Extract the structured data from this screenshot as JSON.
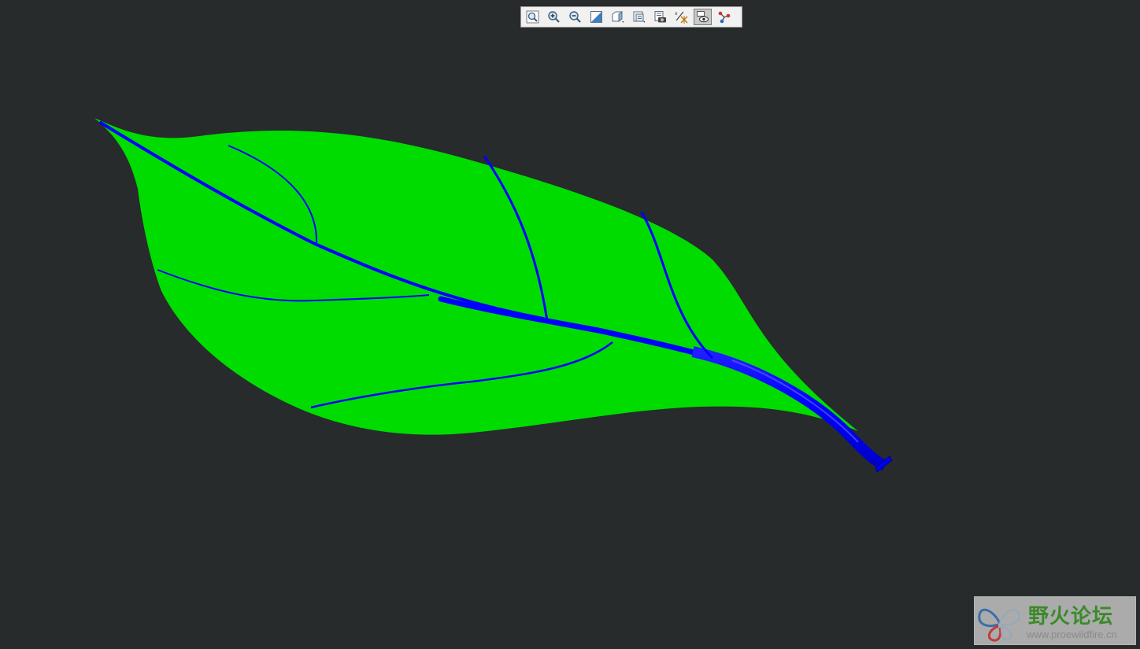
{
  "toolbar": {
    "buttons": [
      {
        "name": "refit-icon"
      },
      {
        "name": "zoom-in-icon"
      },
      {
        "name": "zoom-out-icon"
      },
      {
        "name": "repaint-icon"
      },
      {
        "name": "display-style-icon"
      },
      {
        "name": "saved-views-icon"
      },
      {
        "name": "view-manager-icon"
      },
      {
        "name": "datum-display-icon"
      },
      {
        "name": "annotation-display-icon",
        "active": true
      },
      {
        "name": "spin-center-icon"
      }
    ]
  },
  "model": {
    "leaf_color": "#00dc00",
    "vein_color": "#0000ff",
    "background": "#272b2c"
  },
  "watermark": {
    "title": "野火论坛",
    "url": "www.proewildfire.cn"
  }
}
